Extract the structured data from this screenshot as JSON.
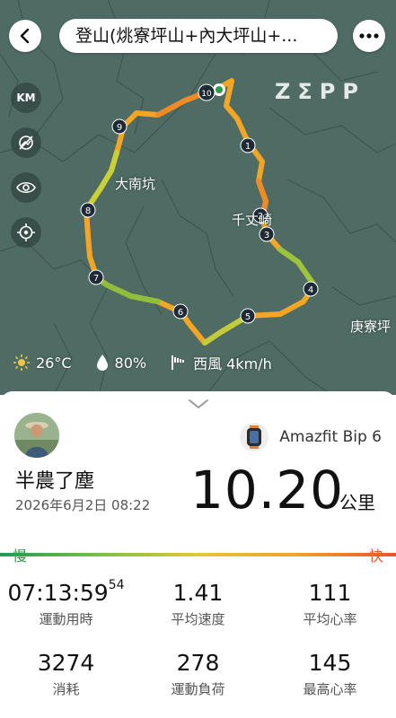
{
  "header": {
    "title": "登山(烑寮坪山+內大坪山+...",
    "brand": "ZΣPP"
  },
  "map": {
    "controls": [
      {
        "name": "km-toggle",
        "label": "KM"
      },
      {
        "name": "no-satellite-icon",
        "label": ""
      },
      {
        "name": "eye-icon",
        "label": ""
      },
      {
        "name": "locate-icon",
        "label": ""
      }
    ],
    "places": [
      {
        "label": "大南坑"
      },
      {
        "label": "千丈崎"
      },
      {
        "label": "庚寮坪"
      }
    ],
    "markers": [
      "1",
      "2",
      "3",
      "4",
      "5",
      "6",
      "7",
      "8",
      "9",
      "10"
    ],
    "route_colors": {
      "slow": "#2e9b4a",
      "fast": "#ea5427",
      "mid": "#f4a02a"
    }
  },
  "weather": {
    "temperature": "26°C",
    "humidity": "80%",
    "wind": "西風 4km/h"
  },
  "activity": {
    "user_name": "半農了塵",
    "date": "2026年6月2日 08:22",
    "device": "Amazfit Bip 6",
    "distance": "10.20",
    "distance_unit": "公里",
    "pace_slow_label": "慢",
    "pace_fast_label": "快"
  },
  "stats": {
    "duration": {
      "value": "07:13:59",
      "sup": "54",
      "label": "運動用時"
    },
    "avg_speed": {
      "value": "1.41",
      "label": "平均速度"
    },
    "avg_hr": {
      "value": "111",
      "label": "平均心率"
    },
    "calories": {
      "value": "3274",
      "label": "消耗"
    },
    "training_load": {
      "value": "278",
      "label": "運動負荷"
    },
    "max_hr": {
      "value": "145",
      "label": "最高心率"
    }
  }
}
